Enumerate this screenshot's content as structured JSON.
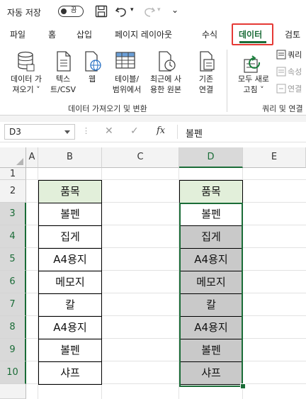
{
  "titlebar": {
    "autosave_label": "자동 저장",
    "toggle_state": "끔"
  },
  "tabs": [
    {
      "label": "파일"
    },
    {
      "label": "홈"
    },
    {
      "label": "삽입"
    },
    {
      "label": "페이지 레이아웃"
    },
    {
      "label": "수식"
    },
    {
      "label": "데이터",
      "active": true
    },
    {
      "label": "검토"
    }
  ],
  "ribbon": {
    "get_data": "데이터 가\n져오기 ˅",
    "text_csv": "텍스\n트/CSV",
    "web": "웹",
    "table_range": "테이블/\n범위에서",
    "recent_sources": "최근에 사\n용한 원본",
    "existing_conn": "기존\n연결",
    "refresh_all": "모두 새로\n고침 ˅",
    "queries": "쿼리",
    "properties": "속성",
    "edit_links": "연결",
    "group_get_transform": "데이터 가져오기 및 변환",
    "group_queries": "쿼리 및 연결"
  },
  "formula_bar": {
    "name_box": "D3",
    "value": "볼펜"
  },
  "columns": [
    "A",
    "B",
    "C",
    "D",
    "E"
  ],
  "rows": [
    "1",
    "2",
    "3",
    "4",
    "5",
    "6",
    "7",
    "8",
    "9",
    "10"
  ],
  "col_B": {
    "header": "품목",
    "items": [
      "볼펜",
      "집게",
      "A4용지",
      "메모지",
      "칼",
      "A4용지",
      "볼펜",
      "샤프"
    ]
  },
  "col_D": {
    "header": "품목",
    "items": [
      "볼펜",
      "집게",
      "A4용지",
      "메모지",
      "칼",
      "A4용지",
      "볼펜",
      "샤프"
    ]
  },
  "colors": {
    "accent": "#1a6c37",
    "highlight_border": "#e53935",
    "header_fill": "#e2efda",
    "selected_fill": "#c9c9c9"
  }
}
